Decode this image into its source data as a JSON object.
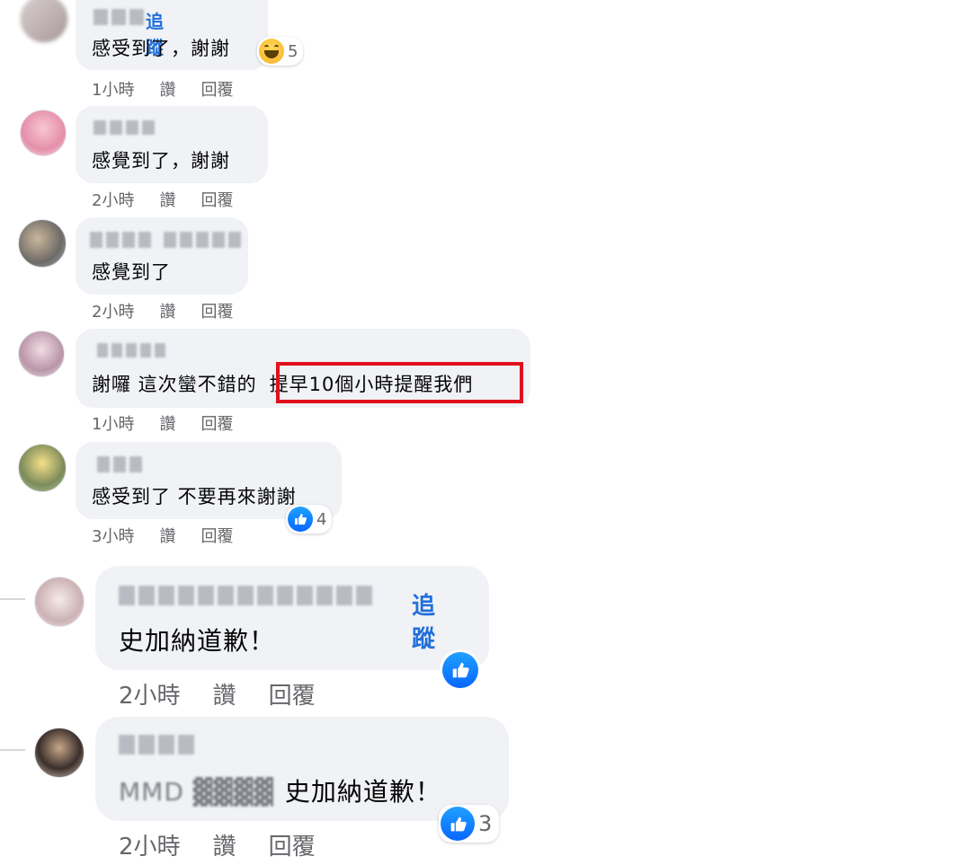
{
  "comments": [
    {
      "follow_label": "追蹤",
      "text": "感受到了，謝謝",
      "time": "1小時",
      "like_label": "讚",
      "reply_label": "回覆",
      "reaction_count": "5",
      "reaction_icon": "haha-icon"
    },
    {
      "text": "感覺到了，謝謝",
      "time": "2小時",
      "like_label": "讚",
      "reply_label": "回覆"
    },
    {
      "text": "感覺到了",
      "time": "2小時",
      "like_label": "讚",
      "reply_label": "回覆"
    },
    {
      "text_prefix": "謝囉 這次蠻不錯的",
      "text_highlight": "提早10個小時提醒我們",
      "time": "1小時",
      "like_label": "讚",
      "reply_label": "回覆",
      "highlight_color": "#e0101c"
    },
    {
      "text": "感受到了 不要再來謝謝",
      "time": "3小時",
      "like_label": "讚",
      "reply_label": "回覆",
      "reaction_count": "4",
      "reaction_icon": "like-icon"
    },
    {
      "follow_label": "追蹤",
      "text": "史加納道歉！",
      "time": "2小時",
      "like_label": "讚",
      "reply_label": "回覆",
      "reaction_icon": "like-icon"
    },
    {
      "text_blurred": "MMD ▓▓▓▓",
      "text": "史加納道歉！",
      "time": "2小時",
      "like_label": "讚",
      "reply_label": "回覆",
      "reaction_count": "3",
      "reaction_icon": "like-icon"
    }
  ],
  "colors": {
    "bubble": "#f0f2f5",
    "link": "#216fdb",
    "meta": "#65676b",
    "like": "#0866ff"
  }
}
